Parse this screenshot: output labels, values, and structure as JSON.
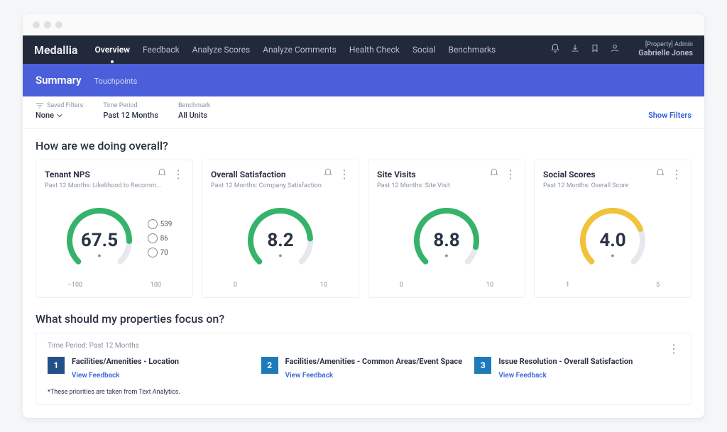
{
  "brand": "Medallia",
  "nav": [
    "Overview",
    "Feedback",
    "Analyze Scores",
    "Analyze Comments",
    "Health Check",
    "Social",
    "Benchmarks"
  ],
  "nav_active_index": 0,
  "user": {
    "role": "[Property] Admin",
    "name": "Gabrielle Jones"
  },
  "subheader": {
    "title": "Summary",
    "tab": "Touchpoints"
  },
  "filters": {
    "saved": {
      "label": "Saved Filters",
      "value": "None"
    },
    "time": {
      "label": "Time Period",
      "value": "Past 12 Months"
    },
    "bench": {
      "label": "Benchmark",
      "value": "All Units"
    },
    "show": "Show Filters"
  },
  "overall_title": "How are we doing overall?",
  "cards": [
    {
      "title": "Tenant NPS",
      "sub": "Past 12 Months: Likelihood to Recomm...",
      "value": "67.5",
      "scale_min": "–100",
      "scale_max": "100",
      "frac": 0.838,
      "color": "#35b36b"
    },
    {
      "title": "Overall Satisfaction",
      "sub": "Past 12 Months: Company Satisfaction",
      "value": "8.2",
      "scale_min": "0",
      "scale_max": "10",
      "frac": 0.82,
      "color": "#35b36b"
    },
    {
      "title": "Site Visits",
      "sub": "Past 12 Months: Site Visit",
      "value": "8.8",
      "scale_min": "0",
      "scale_max": "10",
      "frac": 0.88,
      "color": "#35b36b"
    },
    {
      "title": "Social Scores",
      "sub": "Past 12 Months: Overall Score",
      "value": "4.0",
      "scale_min": "1",
      "scale_max": "5",
      "frac": 0.75,
      "color": "#f1c23b"
    }
  ],
  "sentiments": {
    "happy": "539",
    "neutral": "86",
    "sad": "70"
  },
  "focus": {
    "title": "What should my properties focus on?",
    "meta": "Time Period: Past 12 Months",
    "items": [
      {
        "num": "1",
        "title": "Facilities/Amenities - Location",
        "link": "View Feedback"
      },
      {
        "num": "2",
        "title": "Facilities/Amenities - Common Areas/Event Space",
        "link": "View Feedback"
      },
      {
        "num": "3",
        "title": "Issue Resolution - Overall Satisfaction",
        "link": "View Feedback"
      }
    ],
    "footnote": "*These priorities are taken from Text Analytics."
  },
  "chart_data": [
    {
      "type": "gauge",
      "title": "Tenant NPS",
      "value": 67.5,
      "min": -100,
      "max": 100
    },
    {
      "type": "gauge",
      "title": "Overall Satisfaction",
      "value": 8.2,
      "min": 0,
      "max": 10
    },
    {
      "type": "gauge",
      "title": "Site Visits",
      "value": 8.8,
      "min": 0,
      "max": 10
    },
    {
      "type": "gauge",
      "title": "Social Scores",
      "value": 4.0,
      "min": 1,
      "max": 5
    }
  ]
}
